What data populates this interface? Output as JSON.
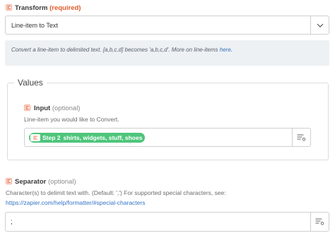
{
  "transform": {
    "label": "Transform",
    "required_tag": "(required)",
    "selected": "Line-item to Text"
  },
  "info": {
    "text": "Convert a line-item to delimited text. [a,b,c,d] becomes 'a,b,c,d'. More on line-items ",
    "link": "here",
    "suffix": "."
  },
  "values_section": {
    "title": "Values",
    "input": {
      "label": "Input",
      "optional_tag": "(optional)",
      "help": "Line-item you would like to Convert.",
      "pill_step": "Step 2",
      "pill_value": "shirts, widgets, stuff, shoes"
    }
  },
  "separator": {
    "label": "Separator",
    "optional_tag": "(optional)",
    "help": "Character(s) to delimit text with. (Default: ',') For supported special characters, see:",
    "link": "https://zapier.com/help/formatter/#special-characters",
    "value": ";"
  },
  "colors": {
    "accent_orange": "#e0592a",
    "pill_green": "#4ec57b",
    "link_blue": "#3474c4"
  },
  "icons": [
    "formatter-icon",
    "chevron-down-icon",
    "list-options-icon",
    "step-app-icon"
  ]
}
